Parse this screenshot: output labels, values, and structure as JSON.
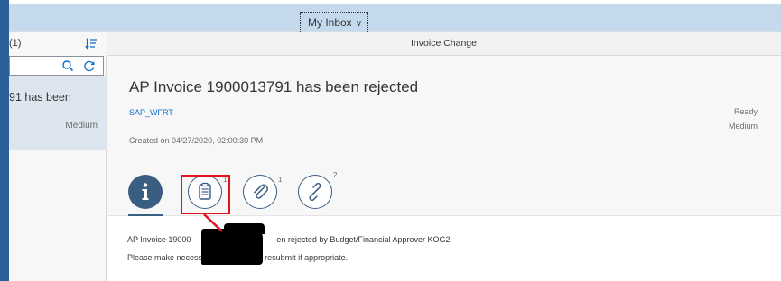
{
  "shell": {
    "app_title": "My Inbox",
    "app_title_chevron": "chevron-down-icon"
  },
  "master": {
    "count_label": "(1)",
    "sort_icon": "sort-icon",
    "search_icon": "search-icon",
    "refresh_icon": "refresh-icon",
    "items": [
      {
        "title": "91 has been",
        "priority": "Medium"
      }
    ]
  },
  "detail": {
    "title_bar": "Invoice Change",
    "header": {
      "title": "AP Invoice 1900013791 has been rejected",
      "created_by": "SAP_WFRT",
      "created_on": "Created on 04/27/2020, 02:00:30 PM",
      "status": "Ready",
      "priority": "Medium"
    },
    "tabs": [
      {
        "name": "info",
        "icon": "info-icon",
        "count": ""
      },
      {
        "name": "notes",
        "icon": "notes-icon",
        "count": "1"
      },
      {
        "name": "attachments",
        "icon": "paperclip-icon",
        "count": "1"
      },
      {
        "name": "links",
        "icon": "link-icon",
        "count": "2"
      }
    ],
    "description": {
      "line1_start": "AP Invoice 19000",
      "line1_end": "en rejected by Budget/Financial Approver KOG2.",
      "line2": "Please make necessary changes and resubmit if appropriate."
    }
  },
  "colors": {
    "shell_background": "#c5d9ec",
    "left_frame": "#2b5f9a",
    "accent": "#3a5d82",
    "link": "#0a6ed1",
    "highlight": "#e0141e",
    "selected_item": "#dde6ee"
  }
}
